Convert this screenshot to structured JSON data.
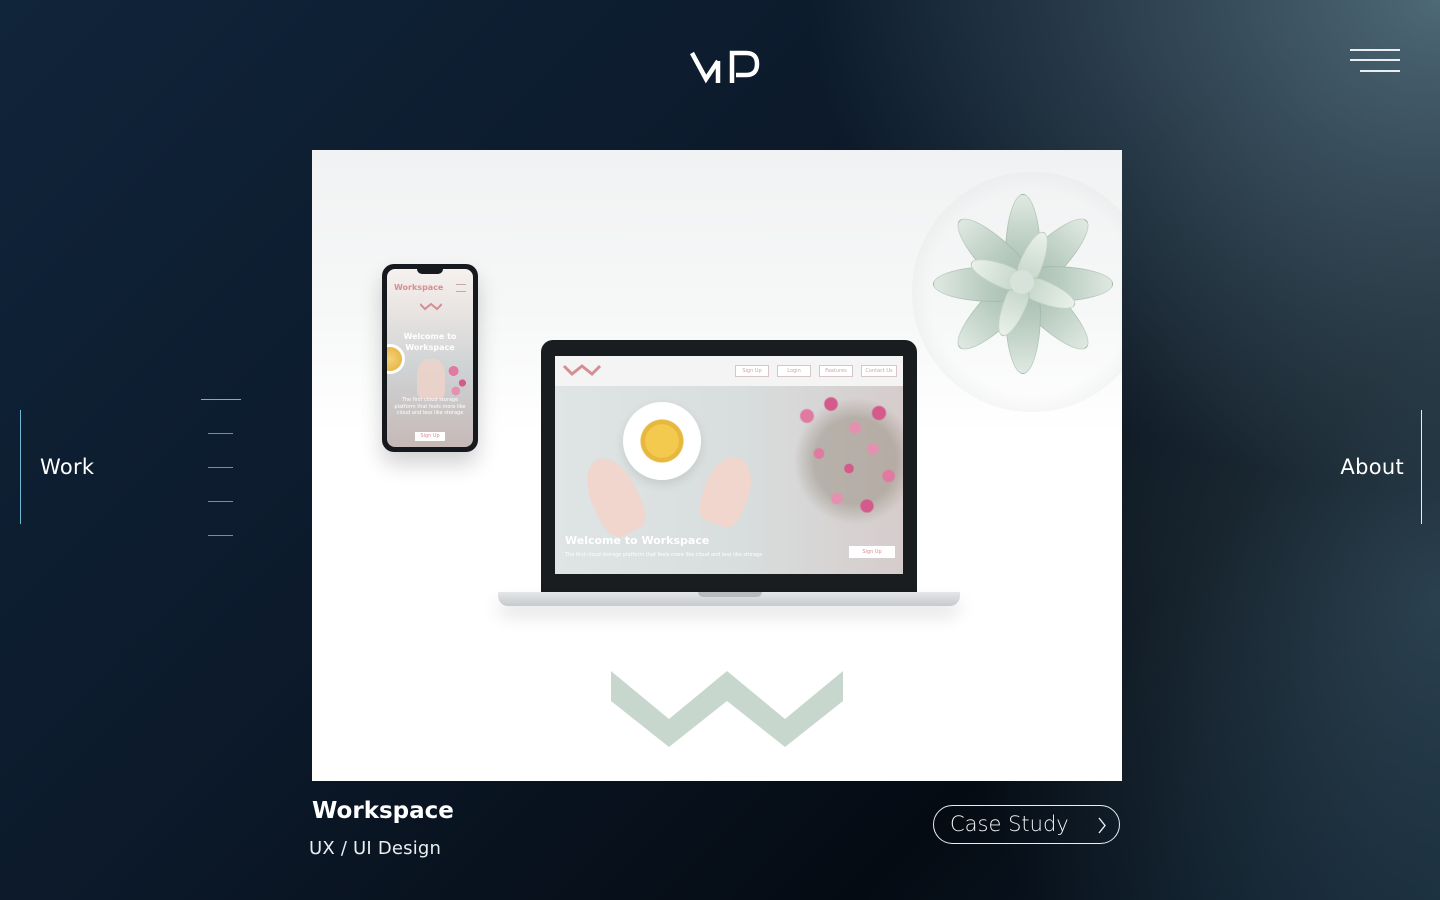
{
  "header": {
    "logo_text": "MP",
    "menu_icon": "hamburger-icon"
  },
  "nav": {
    "left_label": "Work",
    "right_label": "About",
    "slide_indicators": [
      {
        "active": true
      },
      {
        "active": false
      },
      {
        "active": false
      },
      {
        "active": false
      },
      {
        "active": false
      }
    ]
  },
  "project": {
    "title": "Workspace",
    "subtitle": "UX / UI Design",
    "cta_label": "Case Study",
    "cta_icon": "chevron-right-icon"
  },
  "mockup": {
    "phone_brand": "Workspace",
    "phone_welcome": "Welcome to Workspace",
    "phone_tagline": "The first cloud storage platform that feels more like cloud and less like storage",
    "phone_button": "Sign Up",
    "laptop_nav": [
      "Sign Up",
      "Login",
      "Features",
      "Contact Us"
    ],
    "laptop_welcome": "Welcome to Workspace",
    "laptop_tagline": "The first cloud storage platform that feels more like cloud and less like storage",
    "laptop_button": "Sign Up"
  },
  "colors": {
    "accent": "#6fb7d6",
    "brand_mark": "#c8d7ce",
    "background_dark": "#050b13",
    "background_light": "#5a7887"
  }
}
